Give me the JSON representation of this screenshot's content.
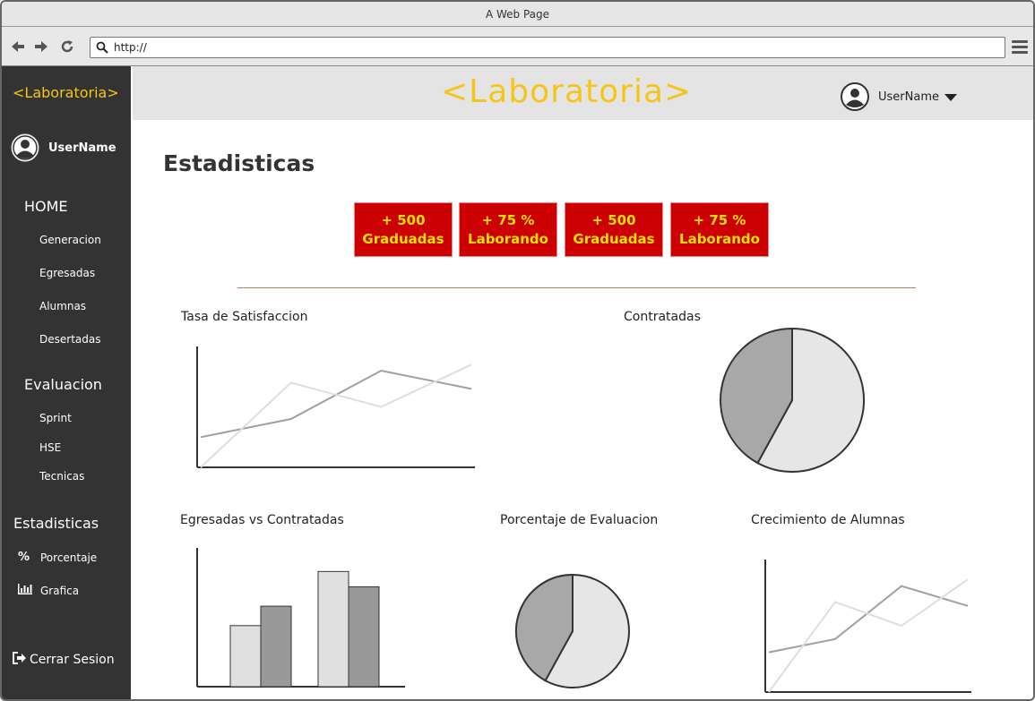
{
  "browser": {
    "title": "A Web Page",
    "url": "http://"
  },
  "sidebar": {
    "logo": "<Laboratoria>",
    "username": "UserName",
    "home": {
      "label": "HOME",
      "items": [
        "Generacion",
        "Egresadas",
        "Alumnas",
        "Desertadas"
      ]
    },
    "evaluacion": {
      "label": "Evaluacion",
      "items": [
        "Sprint",
        "HSE",
        "Tecnicas"
      ]
    },
    "estadisticas": {
      "label": "Estadisticas",
      "items": [
        {
          "label": "Porcentaje",
          "icon": "percent-icon"
        },
        {
          "label": "Grafica",
          "icon": "bar-chart-icon"
        }
      ]
    },
    "logout": "Cerrar Sesion"
  },
  "header": {
    "logo": "<Laboratoria>",
    "username": "UserName"
  },
  "main": {
    "title": "Estadisticas",
    "stats": [
      {
        "value": "+ 500",
        "label": "Graduadas"
      },
      {
        "value": "+ 75 %",
        "label": "Laborando"
      },
      {
        "value": "+ 500",
        "label": "Graduadas"
      },
      {
        "value": "+ 75 %",
        "label": "Laborando"
      }
    ]
  },
  "colors": {
    "accent": "#f5c518",
    "stat_bg": "#cc0000",
    "stat_text": "#f5e000",
    "sidebar_bg": "#333333"
  },
  "chart_data": [
    {
      "type": "line",
      "title": "Tasa de Satisfaccion",
      "x": [
        0,
        1,
        2,
        3
      ],
      "series": [
        {
          "values": [
            0.25,
            0.4,
            0.8,
            0.65
          ]
        },
        {
          "values": [
            0.0,
            0.7,
            0.5,
            0.85
          ]
        }
      ],
      "ylim": [
        0,
        1
      ]
    },
    {
      "type": "pie",
      "title": "Contratadas",
      "values": [
        58,
        42
      ]
    },
    {
      "type": "bar",
      "title": "Egresadas vs Contratadas",
      "categories": [
        "",
        ""
      ],
      "series": [
        {
          "values": [
            44,
            83
          ]
        },
        {
          "values": [
            58,
            72
          ]
        }
      ],
      "ylim": [
        0,
        100
      ]
    },
    {
      "type": "pie",
      "title": "Porcentaje de Evaluacion",
      "values": [
        58,
        42
      ]
    },
    {
      "type": "line",
      "title": "Crecimiento de Alumnas",
      "x": [
        0,
        1,
        2,
        3
      ],
      "series": [
        {
          "values": [
            0.3,
            0.4,
            0.8,
            0.65
          ]
        },
        {
          "values": [
            0.0,
            0.68,
            0.5,
            0.85
          ]
        }
      ],
      "ylim": [
        0,
        1
      ]
    }
  ]
}
